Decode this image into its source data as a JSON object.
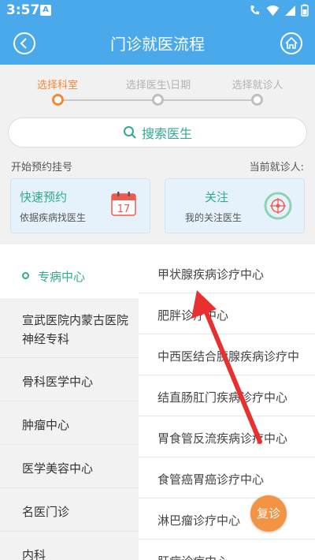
{
  "status": {
    "time": "3:57",
    "notif": "A"
  },
  "nav": {
    "title": "门诊就医流程"
  },
  "steps": [
    {
      "label": "选择科室",
      "active": true
    },
    {
      "label": "选择医生\\日期",
      "active": false
    },
    {
      "label": "选择就诊人",
      "active": false
    }
  ],
  "search": {
    "label": "搜索医生"
  },
  "quick": {
    "left_title": "开始预约挂号",
    "right_title": "当前就诊人:",
    "card1": {
      "title": "快速预约",
      "sub": "依据疾病找医生",
      "calendar_day": "17"
    },
    "card2": {
      "title": "关注",
      "sub": "我的关注医生"
    }
  },
  "sidebar": {
    "items": [
      {
        "label": "专病中心"
      },
      {
        "label": "宣武医院内蒙古医院"
      },
      {
        "label": "神经专科"
      },
      {
        "label": "骨科医学中心"
      },
      {
        "label": "肿瘤中心"
      },
      {
        "label": "医学美容中心"
      },
      {
        "label": "名医门诊"
      },
      {
        "label": "内科"
      }
    ]
  },
  "list": {
    "items": [
      {
        "label": "甲状腺疾病诊疗中心"
      },
      {
        "label": "肥胖诊疗中心"
      },
      {
        "label": "中西医结合胰腺疾病诊疗中"
      },
      {
        "label": "结直肠肛门疾病诊疗中心"
      },
      {
        "label": "胃食管反流疾病诊疗中心"
      },
      {
        "label": "食管癌胃癌诊疗中心"
      },
      {
        "label": "淋巴瘤诊疗中心"
      },
      {
        "label": "肝病诊疗中心"
      }
    ]
  },
  "revisit": {
    "label": "复诊"
  },
  "colors": {
    "header": "#4aa9ea",
    "accent": "#2fa98f",
    "orange": "#f08a3a",
    "arrow": "#e8312f"
  }
}
